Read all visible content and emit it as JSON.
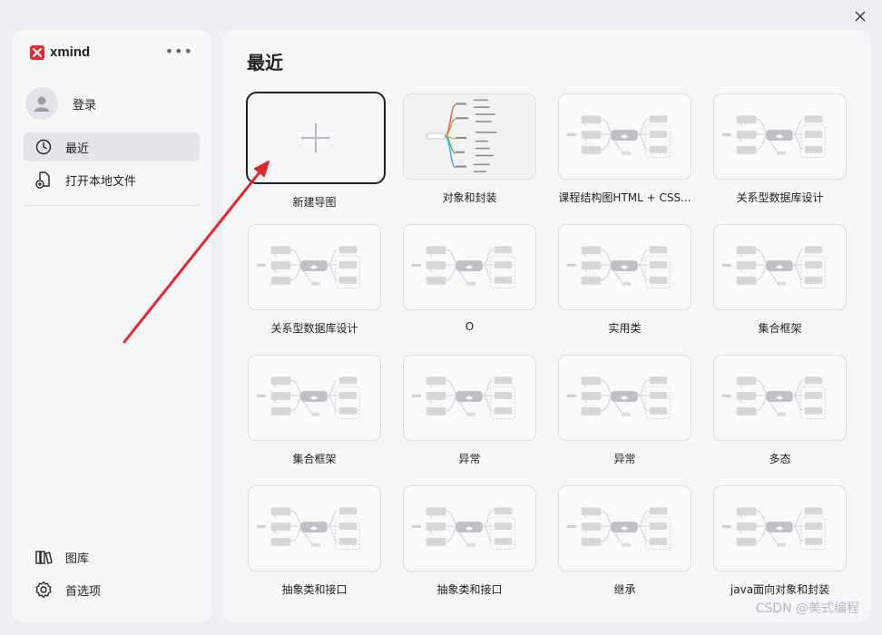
{
  "window": {
    "close_icon": "close-icon"
  },
  "sidebar": {
    "brand": "xmind",
    "more": "•••",
    "login_label": "登录",
    "nav": [
      {
        "label": "最近",
        "icon": "clock-icon",
        "active": true
      },
      {
        "label": "打开本地文件",
        "icon": "open-file-icon",
        "active": false
      }
    ],
    "bottom": [
      {
        "label": "图库",
        "icon": "library-icon"
      },
      {
        "label": "首选项",
        "icon": "gear-icon"
      }
    ]
  },
  "main": {
    "title": "最近",
    "new_card_label": "新建导图",
    "cards": [
      "对象和封装",
      "课程结构图HTML + CSS...",
      "关系型数据库设计",
      "关系型数据库设计",
      "O",
      "实用类",
      "集合框架",
      "集合框架",
      "异常",
      "异常",
      "多态",
      "抽象类和接口",
      "抽象类和接口",
      "继承",
      "java面向对象和封装"
    ]
  },
  "watermark": "CSDN @美式编程",
  "colors": {
    "accent_red": "#e52a2f",
    "arrow_red": "#e0252b"
  }
}
